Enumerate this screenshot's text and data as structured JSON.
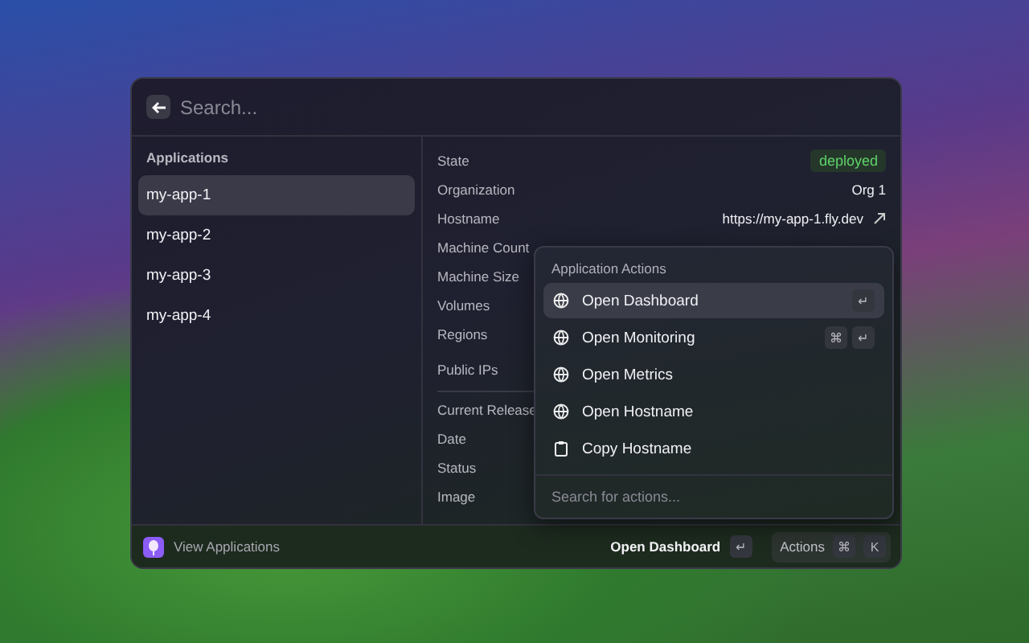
{
  "search": {
    "placeholder": "Search..."
  },
  "sidebar": {
    "title": "Applications",
    "items": [
      {
        "label": "my-app-1",
        "selected": true
      },
      {
        "label": "my-app-2",
        "selected": false
      },
      {
        "label": "my-app-3",
        "selected": false
      },
      {
        "label": "my-app-4",
        "selected": false
      }
    ]
  },
  "details": [
    {
      "label": "State",
      "value": "deployed",
      "kind": "badge"
    },
    {
      "label": "Organization",
      "value": "Org 1",
      "kind": "text"
    },
    {
      "label": "Hostname",
      "value": "https://my-app-1.fly.dev",
      "kind": "link"
    },
    {
      "label": "Machine Count"
    },
    {
      "label": "Machine Size"
    },
    {
      "label": "Volumes"
    },
    {
      "label": "Regions"
    },
    {
      "label": "Public IPs"
    },
    {
      "label": "Current Release",
      "divider_before": true
    },
    {
      "label": "Date"
    },
    {
      "label": "Status"
    },
    {
      "label": "Image"
    }
  ],
  "actions_menu": {
    "title": "Application Actions",
    "items": [
      {
        "label": "Open Dashboard",
        "kind": "link",
        "selected": true,
        "keys": [
          "↵"
        ]
      },
      {
        "label": "Open Monitoring",
        "kind": "link",
        "selected": false,
        "keys": [
          "⌘",
          "↵"
        ]
      },
      {
        "label": "Open Metrics",
        "kind": "link",
        "selected": false
      },
      {
        "label": "Open Hostname",
        "kind": "link",
        "selected": false
      },
      {
        "label": "Copy Hostname",
        "kind": "copy",
        "selected": false
      }
    ],
    "search": {
      "placeholder": "Search for actions..."
    }
  },
  "footer": {
    "title": "View Applications",
    "primary_action": "Open Dashboard",
    "primary_keys": [
      "↵"
    ],
    "actions_label": "Actions",
    "actions_keys": [
      "⌘",
      "K"
    ]
  }
}
